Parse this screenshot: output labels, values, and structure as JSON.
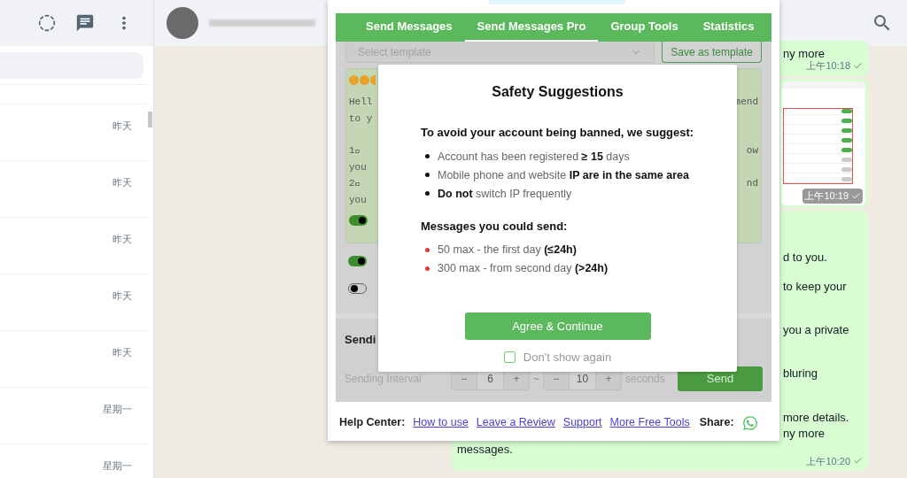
{
  "sidebar": {
    "chats": [
      {
        "time": "昨天"
      },
      {
        "time": "昨天"
      },
      {
        "time": "昨天"
      },
      {
        "time": "昨天"
      },
      {
        "time": "昨天"
      },
      {
        "time": "星期一"
      },
      {
        "time": "星期一"
      }
    ]
  },
  "chat": {
    "messages": [
      {
        "kind": "text",
        "lines": [
          "ny more"
        ],
        "time": "上午10:18"
      },
      {
        "kind": "image",
        "time": "上午10:19"
      },
      {
        "kind": "text",
        "lines": [
          "d to you.",
          "to keep your",
          "you a private",
          "bluring",
          "more details.",
          "ny more"
        ],
        "tail_line": "messages.",
        "time": "上午10:20"
      }
    ]
  },
  "extension": {
    "tabs": [
      {
        "label": "Send Messages",
        "selected": false
      },
      {
        "label": "Send Messages Pro",
        "selected": true
      },
      {
        "label": "Group Tools",
        "selected": false
      },
      {
        "label": "Statistics",
        "selected": false
      }
    ],
    "template_select": {
      "placeholder": "Select template"
    },
    "save_template_button": "Save as template",
    "message_lines": [
      {
        "left": "Hell",
        "right": "mend"
      },
      {
        "left": "to y"
      },
      {
        "left": "1⃣",
        "right": "ow"
      },
      {
        "left": "you"
      },
      {
        "left": "2⃣",
        "right": "nd"
      },
      {
        "left": "you"
      }
    ],
    "toggles": [
      {
        "on": true
      },
      {
        "on": false
      }
    ],
    "message_toggle": {
      "on": true
    },
    "sending_heading": "Sendi",
    "interval": {
      "label": "Sending Interval",
      "min": "6",
      "max": "10",
      "minus": "−",
      "plus": "+",
      "separator": "~",
      "unit": "seconds"
    },
    "send_button": "Send",
    "footer": {
      "label": "Help Center:",
      "links": [
        "How to use",
        "Leave a Review",
        "Support",
        "More Free Tools"
      ],
      "share_label": "Share:"
    },
    "dialog": {
      "title": "Safety Suggestions",
      "sections": [
        {
          "kind": "rules",
          "heading": "To avoid your account being banned, we suggest:",
          "items": [
            "Account has been registered **≥ 15** days",
            "Mobile phone and website **IP are in the same area**",
            "**Do not** switch IP frequently"
          ]
        },
        {
          "kind": "limits",
          "heading": "Messages you could send:",
          "items": [
            "50 max - the first day **(≤24h)**",
            "300 max - from second day **(>24h)**"
          ]
        }
      ],
      "agree_button": "Agree & Continue",
      "dont_show": {
        "label": "Don't show again",
        "checked": false
      }
    }
  }
}
